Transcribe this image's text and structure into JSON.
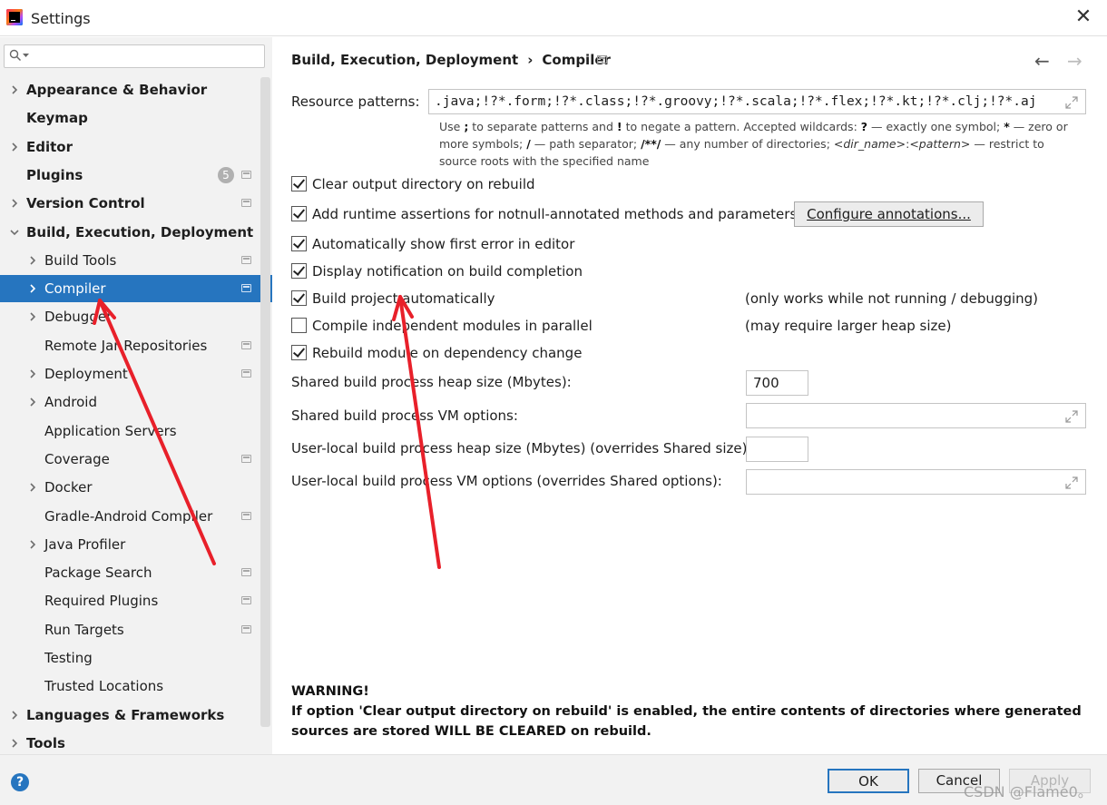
{
  "window": {
    "title": "Settings",
    "close_symbol": "✕"
  },
  "search": {
    "placeholder": ""
  },
  "sidebar": {
    "items": [
      {
        "label": "Appearance & Behavior",
        "bold": true,
        "chevron": "right"
      },
      {
        "label": "Keymap",
        "bold": true
      },
      {
        "label": "Editor",
        "bold": true,
        "chevron": "right"
      },
      {
        "label": "Plugins",
        "bold": true,
        "badge": "5"
      },
      {
        "label": "Version Control",
        "bold": true,
        "chevron": "right"
      },
      {
        "label": "Build, Execution, Deployment",
        "bold": true,
        "chevron": "down"
      },
      {
        "label": "Build Tools",
        "chevron": "right"
      },
      {
        "label": "Compiler",
        "chevron": "right",
        "selected": true
      },
      {
        "label": "Debugger",
        "chevron": "right"
      },
      {
        "label": "Remote Jar Repositories"
      },
      {
        "label": "Deployment",
        "chevron": "right"
      },
      {
        "label": "Android",
        "chevron": "right"
      },
      {
        "label": "Application Servers"
      },
      {
        "label": "Coverage"
      },
      {
        "label": "Docker",
        "chevron": "right"
      },
      {
        "label": "Gradle-Android Compiler"
      },
      {
        "label": "Java Profiler",
        "chevron": "right"
      },
      {
        "label": "Package Search"
      },
      {
        "label": "Required Plugins"
      },
      {
        "label": "Run Targets"
      },
      {
        "label": "Testing"
      },
      {
        "label": "Trusted Locations"
      },
      {
        "label": "Languages & Frameworks",
        "bold": true,
        "chevron": "right"
      },
      {
        "label": "Tools",
        "bold": true,
        "chevron": "right"
      }
    ]
  },
  "breadcrumb": {
    "parent": "Build, Execution, Deployment",
    "separator": "›",
    "current": "Compiler"
  },
  "nav": {
    "back": "←",
    "forward": "→"
  },
  "resource": {
    "label": "Resource patterns:",
    "value": ".java;!?*.form;!?*.class;!?*.groovy;!?*.scala;!?*.flex;!?*.kt;!?*.clj;!?*.aj",
    "hint": {
      "p1": "Use ",
      "b1": ";",
      "p2": " to separate patterns and ",
      "b2": "!",
      "p3": " to negate a pattern. Accepted wildcards: ",
      "b3": "?",
      "p4": " — exactly one symbol; ",
      "b4": "*",
      "p5": " — zero or more symbols; ",
      "b5": "/",
      "p6": " — path separator; ",
      "b6": "/**/",
      "p7": " — any number of directories; ",
      "i1": "<dir_name>",
      "p8": ":",
      "i2": "<pattern>",
      "p9": " — restrict to source roots with the specified name"
    }
  },
  "options": {
    "clear_output": {
      "label": "Clear output directory on rebuild",
      "checked": true
    },
    "runtime_assertions": {
      "label": "Add runtime assertions for notnull-annotated methods and parameters",
      "checked": true
    },
    "show_first_error": {
      "label": "Automatically show first error in editor",
      "checked": true
    },
    "display_notification": {
      "label": "Display notification on build completion",
      "checked": true
    },
    "build_automatically": {
      "label": "Build project automatically",
      "checked": true,
      "note": "(only works while not running / debugging)"
    },
    "compile_parallel": {
      "label": "Compile independent modules in parallel",
      "checked": false,
      "note": "(may require larger heap size)"
    },
    "rebuild_module": {
      "label": "Rebuild module on dependency change",
      "checked": true
    }
  },
  "configure_button": "Configure annotations...",
  "fields": {
    "shared_heap": {
      "label": "Shared build process heap size (Mbytes):",
      "value": "700"
    },
    "shared_vm": {
      "label": "Shared build process VM options:",
      "value": ""
    },
    "user_heap": {
      "label": "User-local build process heap size (Mbytes) (overrides Shared size):",
      "value": ""
    },
    "user_vm": {
      "label": "User-local build process VM options (overrides Shared options):",
      "value": ""
    }
  },
  "warning": {
    "title": "WARNING!",
    "text": "If option 'Clear output directory on rebuild' is enabled, the entire contents of directories where generated sources are stored WILL BE CLEARED on rebuild."
  },
  "buttons": {
    "ok": "OK",
    "cancel": "Cancel",
    "apply": "Apply",
    "help": "?"
  },
  "watermark": "CSDN @Flame0。",
  "colors": {
    "selection": "#2675bf",
    "annotation_arrow": "#e8202a"
  },
  "icons": {
    "search": "search-icon",
    "chevron_right": "chevron-right-icon",
    "chevron_down": "chevron-down-icon",
    "settings_mark": "project-settings-icon",
    "expand": "expand-icon",
    "help": "help-icon"
  }
}
